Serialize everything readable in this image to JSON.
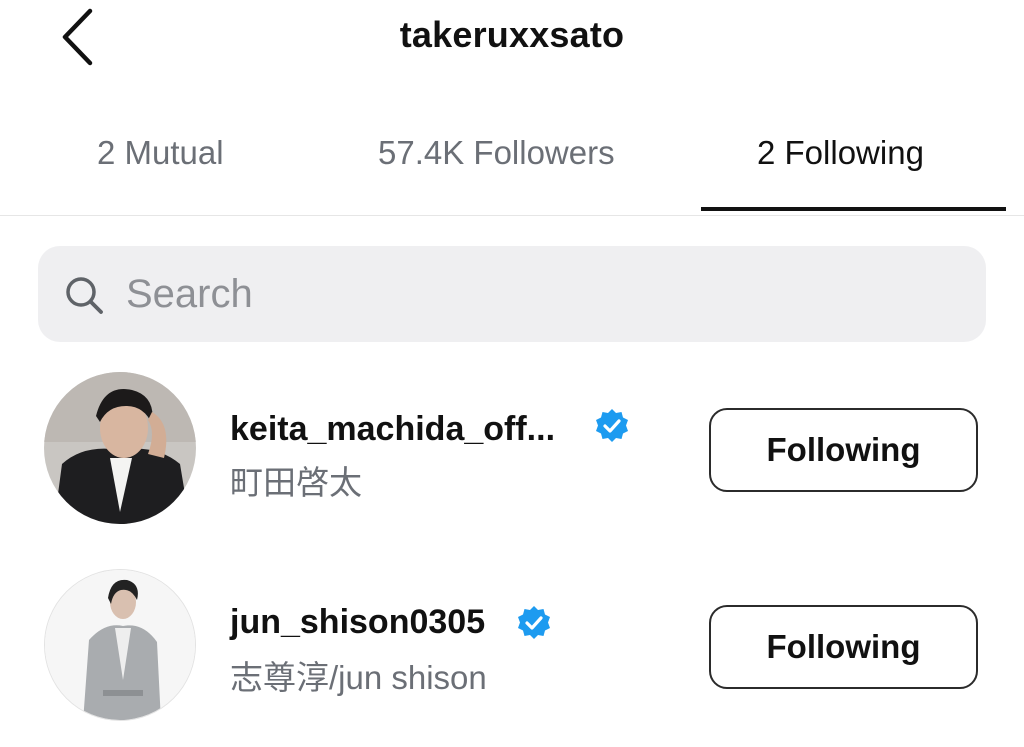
{
  "header": {
    "title": "takeruxxsato"
  },
  "tabs": [
    {
      "label": "2 Mutual",
      "active": false
    },
    {
      "label": "57.4K Followers",
      "active": false
    },
    {
      "label": "2 Following",
      "active": true
    }
  ],
  "search": {
    "placeholder": "Search",
    "value": ""
  },
  "accounts": [
    {
      "username": "keita_machida_off...",
      "full_name": "町田啓太",
      "verified": true,
      "button_label": "Following"
    },
    {
      "username": "jun_shison0305",
      "full_name": "志尊淳/jun shison",
      "verified": true,
      "button_label": "Following"
    }
  ],
  "colors": {
    "verified_badge": "#1d9bf0",
    "tab_inactive": "#6b6f76",
    "search_bg": "#efeff1"
  }
}
